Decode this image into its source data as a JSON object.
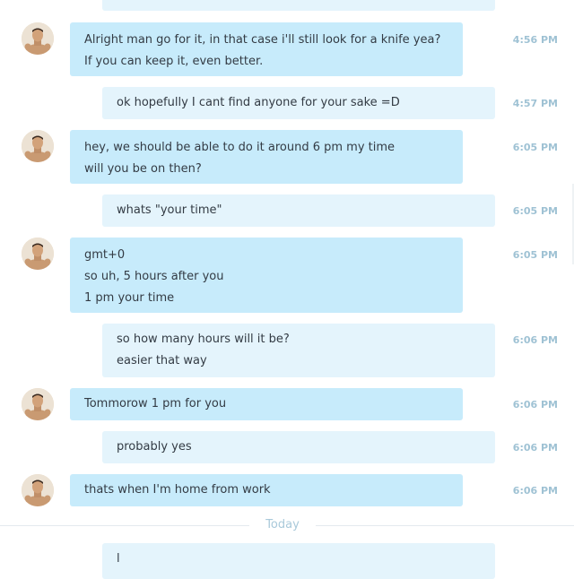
{
  "messages": [
    {
      "lines": [
        ""
      ],
      "time": ""
    },
    {
      "lines": [
        "Alright man go for it, in that case i'll still look for a knife yea?",
        "If you can keep it, even better."
      ],
      "time": "4:56 PM"
    },
    {
      "lines": [
        "ok hopefully I cant find anyone for your sake =D"
      ],
      "time": "4:57 PM"
    },
    {
      "lines": [
        "hey, we should be able to do it around 6 pm my time",
        "will you be on then?"
      ],
      "time": "6:05 PM"
    },
    {
      "lines": [
        "whats \"your time\""
      ],
      "time": "6:05 PM"
    },
    {
      "lines": [
        "gmt+0",
        "so uh, 5 hours after you",
        "1 pm your time"
      ],
      "time": "6:05 PM"
    },
    {
      "lines": [
        "so how many hours will it be?",
        "easier that way"
      ],
      "time": "6:06 PM"
    },
    {
      "lines": [
        "Tommorow 1 pm for you"
      ],
      "time": "6:06 PM"
    },
    {
      "lines": [
        "probably yes"
      ],
      "time": "6:06 PM"
    },
    {
      "lines": [
        "thats when I'm home from work"
      ],
      "time": "6:06 PM"
    },
    {
      "lines": [
        "l"
      ],
      "time": ""
    }
  ],
  "divider": {
    "label": "Today"
  },
  "colors": {
    "incoming_bubble": "#c7ebfb",
    "outgoing_bubble": "#e4f4fc",
    "timestamp": "#9fc2d4",
    "divider_label": "#a9c9da"
  },
  "icons": {
    "avatar": "user-avatar-photo"
  }
}
